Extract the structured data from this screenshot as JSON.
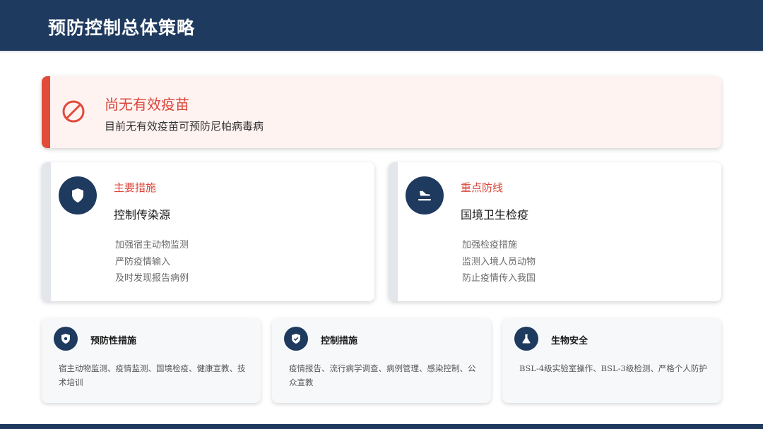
{
  "header": {
    "title": "预防控制总体策略"
  },
  "alert": {
    "title": "尚无有效疫苗",
    "subtitle": "目前无有效疫苗可预防尼帕病毒病",
    "icon": "prohibited-icon",
    "accent_color": "#e04b3a"
  },
  "cards": [
    {
      "icon": "shield-icon",
      "kicker": "主要措施",
      "title": "控制传染源",
      "items": [
        "加强宿主动物监测",
        "严防疫情输入",
        "及时发现报告病例"
      ]
    },
    {
      "icon": "plane-landing-icon",
      "kicker": "重点防线",
      "title": "国境卫生检疫",
      "items": [
        "加强检疫措施",
        "监测入境人员动物",
        "防止疫情传入我国"
      ]
    }
  ],
  "small_cards": [
    {
      "icon": "shield-virus-icon",
      "title": "预防性措施",
      "body": "宿主动物监测、疫情监测、国境检疫、健康宣教、技术培训"
    },
    {
      "icon": "shield-check-icon",
      "title": "控制措施",
      "body": "疫情报告、流行病学调查、病例管理、感染控制、公众宣教"
    },
    {
      "icon": "flask-icon",
      "title": "生物安全",
      "body": "BSL-4级实验室操作、BSL-3级检测、严格个人防护"
    }
  ],
  "colors": {
    "navy": "#1f3a5f",
    "accent_red": "#d9473a"
  }
}
